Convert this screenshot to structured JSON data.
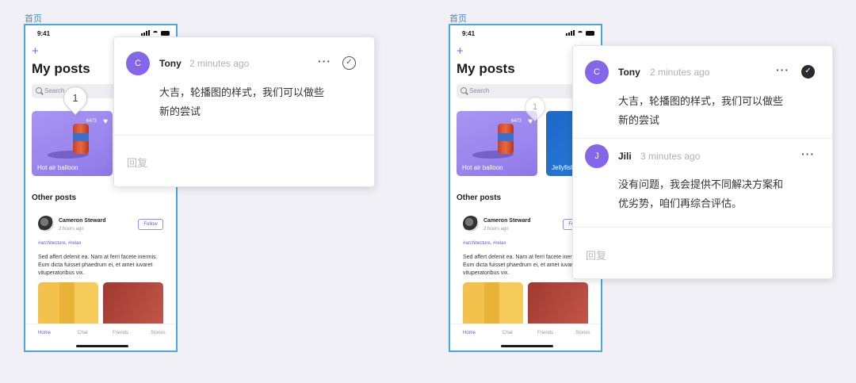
{
  "frame_label": "首页",
  "phone": {
    "status_time": "9:41",
    "plus": "+",
    "title": "My posts",
    "search_placeholder": "Search",
    "card1": {
      "caption": "Hot air balloon",
      "count": "6473"
    },
    "card2": {
      "caption": "Jellyfish"
    },
    "pin_number": "1",
    "other_title": "Other posts",
    "author": {
      "name": "Cameron Steward",
      "time": "2 hours ago"
    },
    "follow_label": "Follow",
    "tags": "#architecture, #relax",
    "body": "Sed affert delenit ea. Nam at ferri facete inermis. Eum dicta fuisset phaedrum ei, et amet iuvaret vituperatoribus vix.",
    "tabs": [
      "Home",
      "Chat",
      "Friends",
      "Stories"
    ]
  },
  "left_comments": {
    "comment": {
      "avatar": "C",
      "name": "Tony",
      "time": "2 minutes ago",
      "more": "···",
      "text_line1": "大吉，轮播图的样式，我们可以做些",
      "text_line2": "新的尝试"
    },
    "reply_placeholder": "回复"
  },
  "right_comments": {
    "comment1": {
      "avatar": "C",
      "name": "Tony",
      "time": "2 minutes ago",
      "more": "···",
      "text_line1": "大吉，轮播图的样式，我们可以做些",
      "text_line2": "新的尝试"
    },
    "comment2": {
      "avatar": "J",
      "name": "Jili",
      "time": "3 minutes ago",
      "more": "···",
      "text_line1": "没有问题，我会提供不同解决方案和",
      "text_line2": "优劣势，咱们再综合评估。"
    },
    "reply_placeholder": "回复"
  }
}
